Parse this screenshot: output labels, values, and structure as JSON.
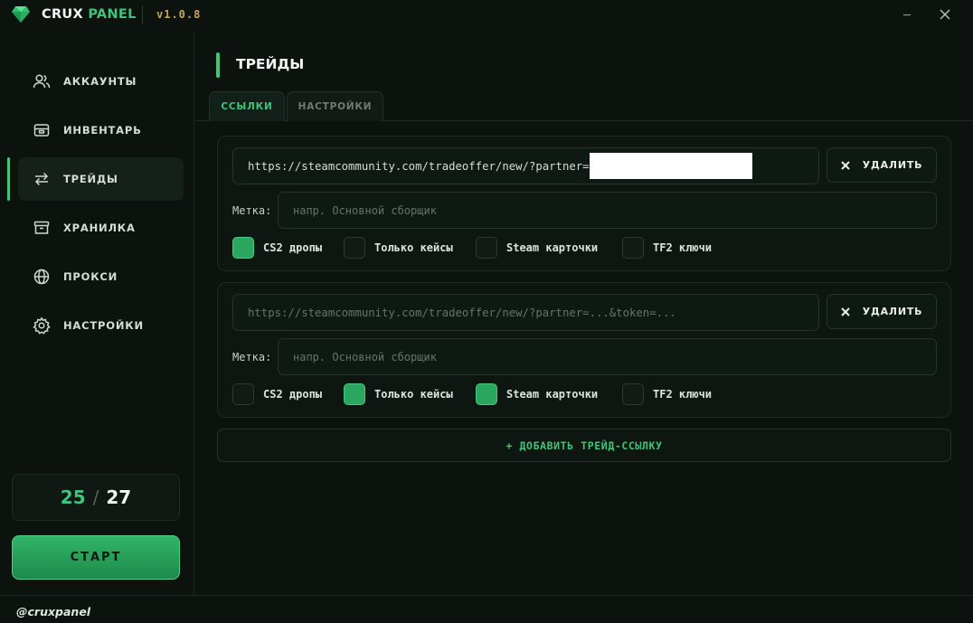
{
  "app": {
    "brand_main": "CRUX",
    "brand_accent": "PANEL",
    "version": "v1.0.8",
    "accent_color": "#3fc57a"
  },
  "sidebar": {
    "items": [
      {
        "label": "АККАУНТЫ",
        "icon": "users-icon",
        "active": false
      },
      {
        "label": "ИНВЕНТАРЬ",
        "icon": "inventory-icon",
        "active": false
      },
      {
        "label": "ТРЕЙДЫ",
        "icon": "swap-arrows-icon",
        "active": true
      },
      {
        "label": "ХРАНИЛКА",
        "icon": "archive-box-icon",
        "active": false
      },
      {
        "label": "ПРОКСИ",
        "icon": "globe-icon",
        "active": false
      },
      {
        "label": "НАСТРОЙКИ",
        "icon": "gear-icon",
        "active": false
      }
    ],
    "counter_current": "25",
    "counter_separator": "/",
    "counter_total": "27",
    "start_label": "СТАРТ"
  },
  "main": {
    "title": "ТРЕЙДЫ",
    "tabs": [
      {
        "label": "ССЫЛКИ",
        "active": true
      },
      {
        "label": "НАСТРОЙКИ",
        "active": false
      }
    ],
    "trade_links": [
      {
        "url_value": "https://steamcommunity.com/tradeoffer/new/?partner=",
        "url_placeholder": "https://steamcommunity.com/tradeoffer/new/?partner=...&token=...",
        "url_redacted": true,
        "delete_label": "УДАЛИТЬ",
        "label_caption": "Метка:",
        "label_placeholder": "напр. Основной сборщик",
        "options": [
          {
            "label": "CS2 дропы",
            "checked": true
          },
          {
            "label": "Только кейсы",
            "checked": false
          },
          {
            "label": "Steam карточки",
            "checked": false
          },
          {
            "label": "TF2 ключи",
            "checked": false
          }
        ]
      },
      {
        "url_value": "",
        "url_placeholder": "https://steamcommunity.com/tradeoffer/new/?partner=...&token=...",
        "url_redacted": false,
        "delete_label": "УДАЛИТЬ",
        "label_caption": "Метка:",
        "label_placeholder": "напр. Основной сборщик",
        "options": [
          {
            "label": "CS2 дропы",
            "checked": false
          },
          {
            "label": "Только кейсы",
            "checked": true
          },
          {
            "label": "Steam карточки",
            "checked": true
          },
          {
            "label": "TF2 ключи",
            "checked": false
          }
        ]
      }
    ],
    "add_label": "+ ДОБАВИТЬ ТРЕЙД-ССЫЛКУ"
  },
  "footer": {
    "handle": "@cruxpanel"
  }
}
